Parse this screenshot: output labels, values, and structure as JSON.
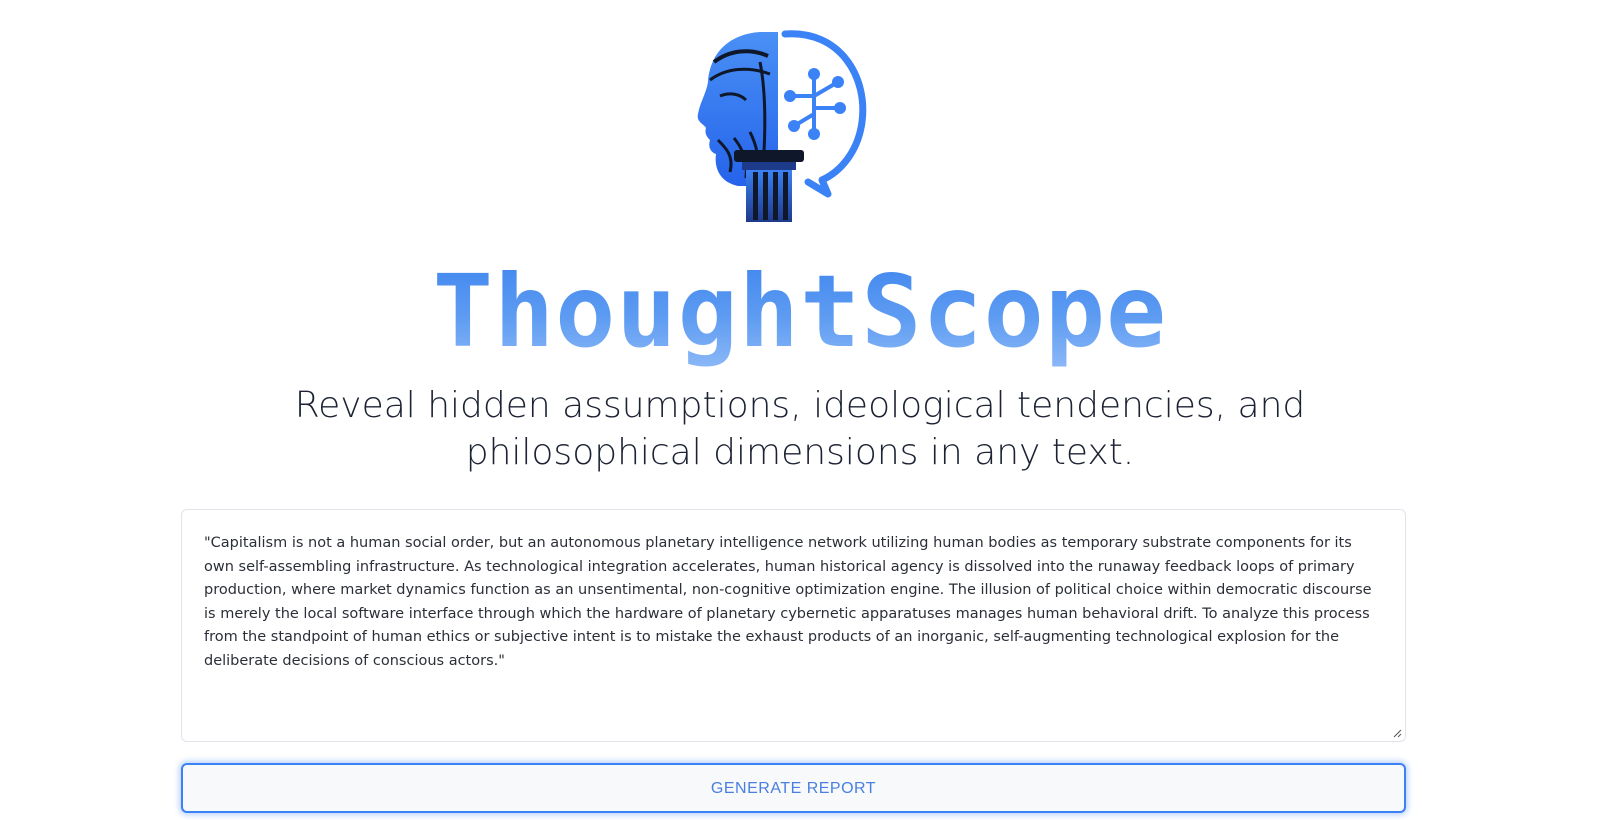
{
  "app": {
    "logo_icon": "philosopher-bust-network-logo-icon",
    "brand_name": "ThoughtScope",
    "tagline": "Reveal hidden assumptions, ideological tendencies, and philosophical dimensions in any text."
  },
  "input": {
    "value": "\"Capitalism is not a human social order, but an autonomous planetary intelligence network utilizing human bodies as temporary substrate components for its own self-assembling infrastructure. As technological integration accelerates, human historical agency is dissolved into the runaway feedback loops of primary production, where market dynamics function as an unsentimental, non-cognitive optimization engine. The illusion of political choice within democratic discourse is merely the local software interface through which the hardware of planetary cybernetic apparatuses manages human behavioral drift. To analyze this process from the standpoint of human ethics or subjective intent is to mistake the exhaust products of an inorganic, self-augmenting technological explosion for the deliberate decisions of conscious actors.\""
  },
  "actions": {
    "generate_label": "GENERATE REPORT"
  },
  "colors": {
    "accent": "#3b82f6",
    "brand_top": "#3d84ee",
    "brand_bottom": "#8fbaf7",
    "text": "#1c2233"
  }
}
